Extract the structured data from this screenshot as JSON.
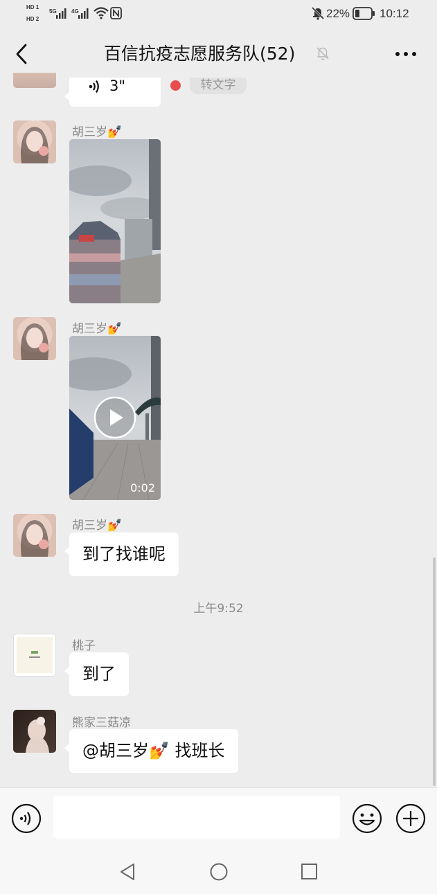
{
  "status_bar": {
    "sim1": "HD 1",
    "sim2": "HD 2",
    "net1": "5G",
    "net2": "4G",
    "battery": "22%",
    "time": "10:12"
  },
  "header": {
    "title": "百信抗疫志愿服务队(52)"
  },
  "messages": {
    "voice": {
      "duration": "3\"",
      "to_text_label": "转文字"
    },
    "m1": {
      "sender": "胡三岁💅"
    },
    "m2": {
      "sender": "胡三岁💅",
      "video_duration": "0:02"
    },
    "m3": {
      "sender": "胡三岁💅",
      "text": "到了找谁呢"
    },
    "timestamp": "上午9:52",
    "m4": {
      "sender": "桃子",
      "text": "到了"
    },
    "m5": {
      "sender": "熊家三菇凉",
      "text": "@胡三岁💅 找班长"
    }
  },
  "colors": {
    "background": "#ededed",
    "bubble": "#ffffff",
    "unread_dot": "#e84d4d",
    "sender_gray": "#8a8a8a"
  },
  "icons": {
    "back": "chevron-left-icon",
    "mute": "bell-off-icon",
    "more": "more-dots-icon",
    "voice_input": "voice-icon",
    "emoji": "emoji-icon",
    "add": "plus-icon"
  }
}
